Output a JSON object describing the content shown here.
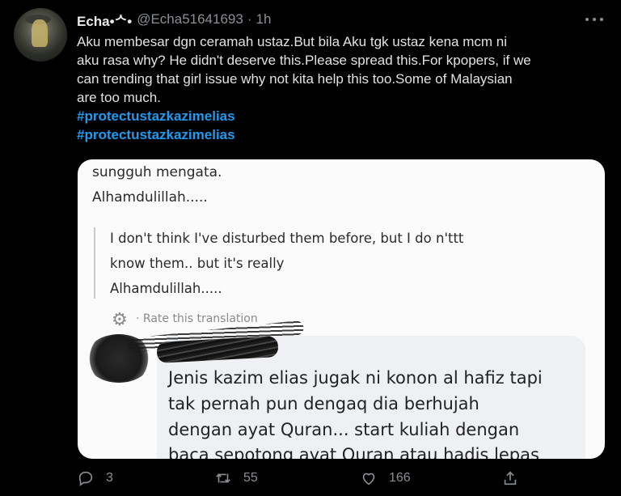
{
  "tweet": {
    "display_name": "Echa•ᄉ•",
    "handle": "@Echa51641693",
    "separator": "·",
    "time": "1h",
    "text_line1": "Aku membesar dgn ceramah ustaz.But bila Aku tgk ustaz kena mcm ni",
    "text_line2": "aku rasa why? He didn't deserve this.Please spread this.For kpopers, if we",
    "text_line3": "can trending that girl issue why not kita help this too.Some of Malaysian",
    "text_line4": "are too much.",
    "hashtags": [
      "#protectustazkazimelias",
      "#protectustazkazimelias"
    ]
  },
  "media": {
    "line1": "sungguh mengata.",
    "line2": "Alhamdulillah.....",
    "translation_line1": "I don't think I've disturbed them before, but I do n'ttt",
    "translation_line2": "know them.. but it's really",
    "translation_line3": "Alhamdulillah.....",
    "rate_label": "· Rate this translation",
    "comment_line1": "Jenis kazim elias jugak ni konon al hafiz tapi",
    "comment_line2": "tak pernah pun dengaq dia berhujah",
    "comment_line3": "dengan ayat Quran... start kuliah dengan",
    "comment_line4": "baca sepotong ayat Quran atau hadis lepas"
  },
  "actions": {
    "reply_count": "3",
    "retweet_count": "55",
    "like_count": "166"
  },
  "icons": {
    "reply": "reply-icon",
    "retweet": "retweet-icon",
    "like": "heart-icon",
    "share": "share-icon",
    "more": "more-icon",
    "gear": "gear-icon"
  },
  "colors": {
    "background": "#000000",
    "hashtag": "#1d9bf0",
    "muted": "#8a8f95"
  }
}
